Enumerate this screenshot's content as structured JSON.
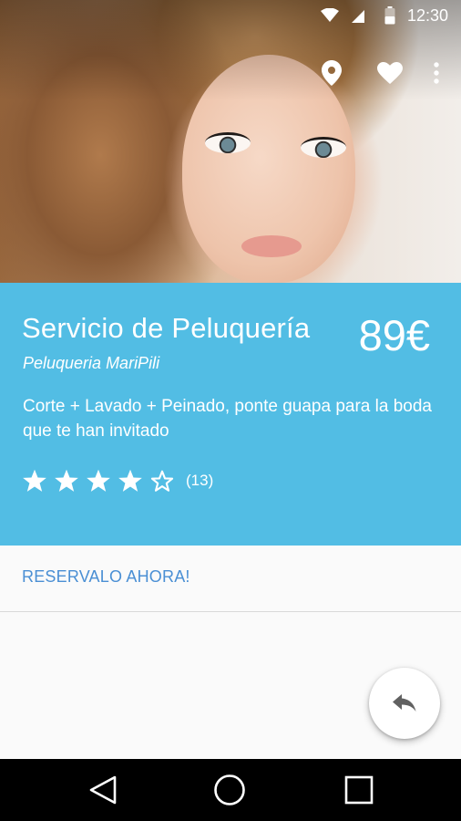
{
  "status_bar": {
    "time": "12:30",
    "icons": [
      "wifi-icon",
      "cell-signal-icon",
      "battery-icon"
    ]
  },
  "hero": {
    "image": "woman-portrait-photo",
    "actions": [
      {
        "name": "location-pin-icon"
      },
      {
        "name": "heart-icon"
      },
      {
        "name": "more-vert-icon"
      }
    ]
  },
  "service": {
    "title": "Servicio de Peluquería",
    "price": "89€",
    "provider": "Peluqueria MariPili",
    "description": "Corte + Lavado + Peinado, ponte guapa para la boda que te han invitado",
    "rating": {
      "stars_filled": 4,
      "stars_total": 5,
      "count": "(13)"
    }
  },
  "actions": {
    "reserve_label": "RESERVALO AHORA!",
    "share_icon": "reply-share-icon"
  },
  "nav_bar": {
    "buttons": [
      "back-icon",
      "home-icon",
      "recents-icon"
    ]
  },
  "colors": {
    "info_background": "#52bde4",
    "reserve_text": "#4a8fd4",
    "page_background": "#fafafa"
  }
}
